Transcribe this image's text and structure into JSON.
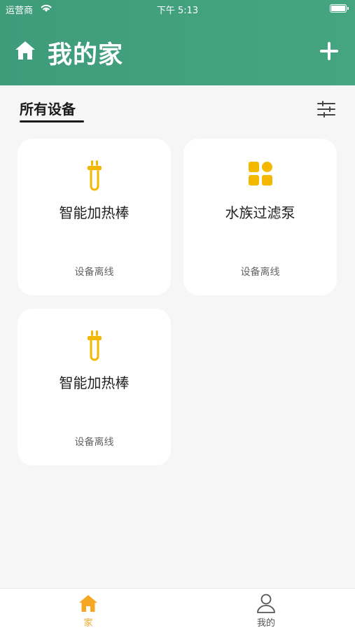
{
  "status_bar": {
    "carrier": "运营商",
    "time": "下午 5:13"
  },
  "header": {
    "title": "我的家"
  },
  "tabs": {
    "all_devices": "所有设备"
  },
  "devices": [
    {
      "name": "智能加热棒",
      "status": "设备离线",
      "icon": "heater-plug-icon"
    },
    {
      "name": "水族过滤泵",
      "status": "设备离线",
      "icon": "grid-apps-icon"
    },
    {
      "name": "智能加热棒",
      "status": "设备离线",
      "icon": "heater-plug-icon"
    }
  ],
  "tab_bar": [
    {
      "label": "家",
      "icon": "home-icon",
      "active": true
    },
    {
      "label": "我的",
      "icon": "person-icon",
      "active": false
    }
  ],
  "colors": {
    "header": "#3f9c7b",
    "accent": "#f5a623",
    "background": "#f6f6f6"
  }
}
